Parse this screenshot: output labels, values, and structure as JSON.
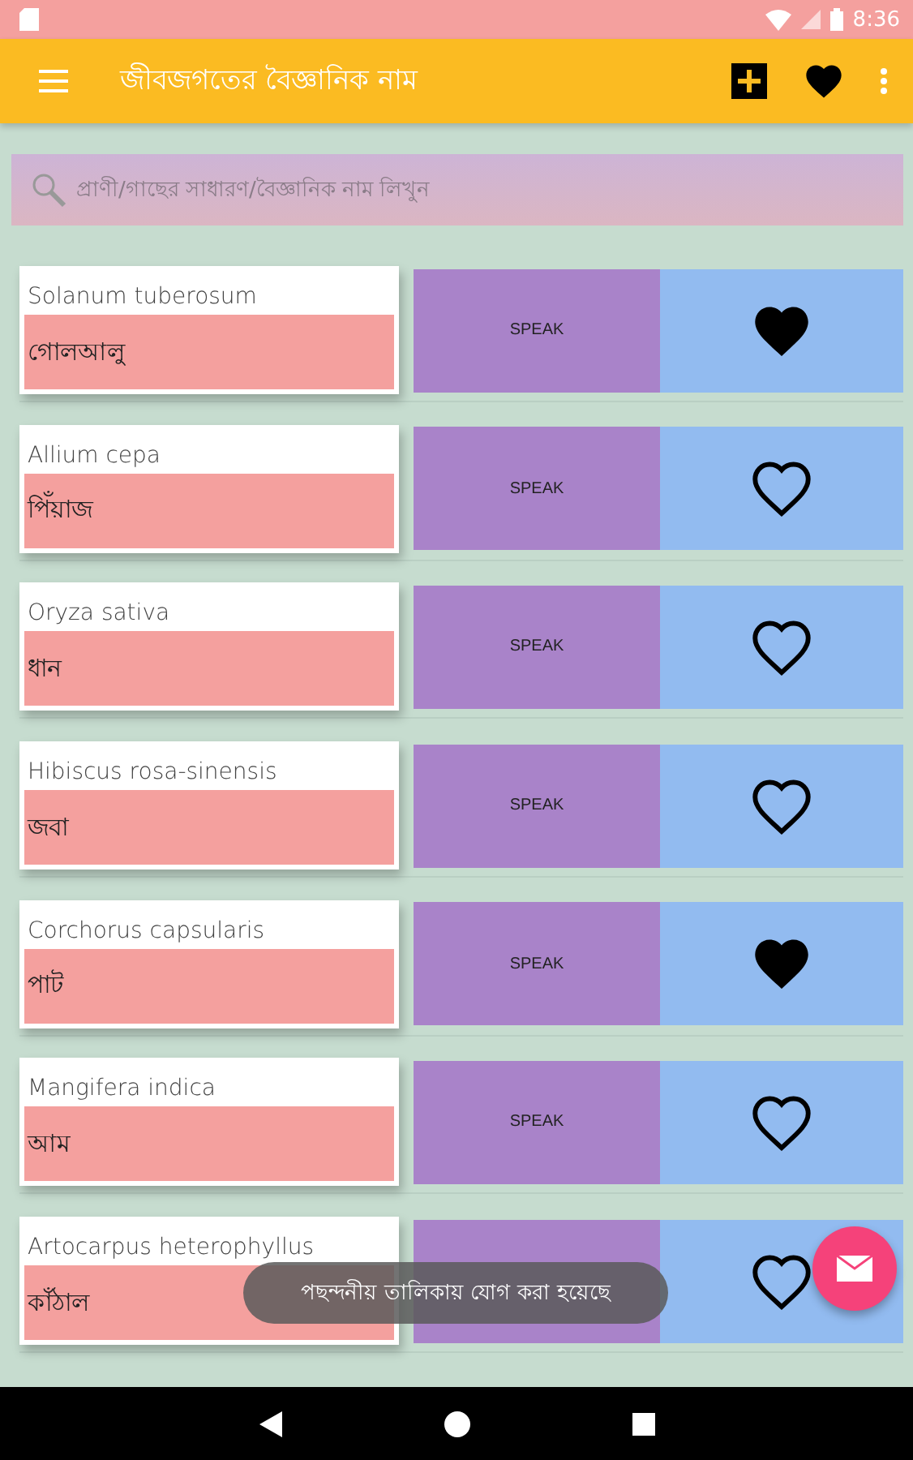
{
  "status_bar": {
    "time": "8:36"
  },
  "app_bar": {
    "title": "জীবজগতের বৈজ্ঞানিক নাম"
  },
  "search": {
    "placeholder": "প্রাণী/গাছের সাধারণ/বৈজ্ঞানিক নাম লিখুন"
  },
  "items": [
    {
      "scientific": "Solanum tuberosum",
      "common": "গোলআলু",
      "speak": "SPEAK",
      "favorite": true
    },
    {
      "scientific": "Allium cepa",
      "common": "পিঁয়াজ",
      "speak": "SPEAK",
      "favorite": false
    },
    {
      "scientific": "Oryza sativa",
      "common": "ধান",
      "speak": "SPEAK",
      "favorite": false
    },
    {
      "scientific": "Hibiscus rosa-sinensis",
      "common": "জবা",
      "speak": "SPEAK",
      "favorite": false
    },
    {
      "scientific": "Corchorus capsularis",
      "common": "পাট",
      "speak": "SPEAK",
      "favorite": true
    },
    {
      "scientific": "Mangifera indica",
      "common": "আম",
      "speak": "SPEAK",
      "favorite": false
    },
    {
      "scientific": "Artocarpus heterophyllus",
      "common": "কাঁঠাল",
      "favorite": false
    }
  ],
  "toast": "পছন্দনীয় তালিকায় যোগ করা হয়েছে"
}
